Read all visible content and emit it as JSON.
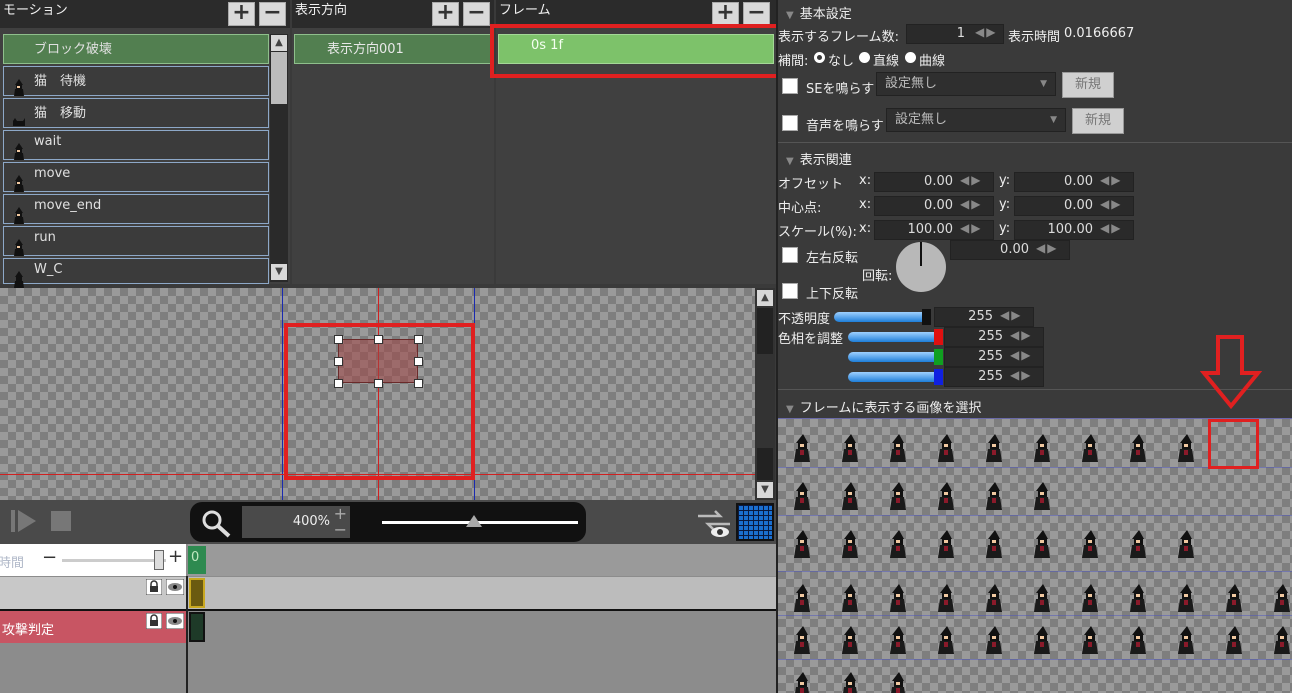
{
  "motion": {
    "header": "モーション",
    "items": [
      {
        "label": "ブロック破壊",
        "selected": true
      },
      {
        "label": "猫　待機",
        "selected": false
      },
      {
        "label": "猫　移動",
        "selected": false
      },
      {
        "label": "wait",
        "selected": false
      },
      {
        "label": "move",
        "selected": false
      },
      {
        "label": "move_end",
        "selected": false
      },
      {
        "label": "run",
        "selected": false
      },
      {
        "label": "W_C",
        "selected": false
      }
    ]
  },
  "direction": {
    "header": "表示方向",
    "items": [
      {
        "label": "表示方向001"
      }
    ]
  },
  "frame": {
    "header": "フレーム",
    "items": [
      {
        "label": "0s 1f"
      }
    ]
  },
  "icons": {
    "plus": "+",
    "minus": "−",
    "scroll_up": "▲",
    "scroll_down": "▼",
    "play": "▶",
    "stop": "■",
    "search": "search-icon"
  },
  "toolbar": {
    "zoom_value": "400%",
    "zoom_plus": "+",
    "zoom_minus": "−",
    "zoom_slider_level": 0.47
  },
  "timeline": {
    "time_label": "時間",
    "time_marker": "0",
    "tracks": [
      {
        "name": "",
        "color": "#c8c8c8"
      },
      {
        "name": "攻撃判定",
        "color": "#c85563"
      }
    ]
  },
  "basic": {
    "title": "基本設定",
    "frame_count_label": "表示するフレーム数:",
    "frame_count": "1",
    "display_time_label": "表示時間",
    "display_time": "0.0166667",
    "interp_label": "補間:",
    "interp_options": [
      "なし",
      "直線",
      "曲線"
    ],
    "interp_selected": 0,
    "se_label": "SEを鳴らす",
    "se_value": "設定無し",
    "se_new": "新規",
    "voice_label": "音声を鳴らす",
    "voice_value": "設定無し",
    "voice_new": "新規"
  },
  "display": {
    "title": "表示関連",
    "offset_label": "オフセット",
    "offset_x": "0.00",
    "offset_y": "0.00",
    "center_label": "中心点:",
    "center_x": "0.00",
    "center_y": "0.00",
    "scale_label": "スケール(%):",
    "scale_x": "100.00",
    "scale_y": "100.00",
    "x_label": "x:",
    "y_label": "y:",
    "flip_h_label": "左右反転",
    "rotation_label": "回転:",
    "rotation_value": "0.00",
    "flip_v_label": "上下反転",
    "opacity_label": "不透明度",
    "opacity_value": "255",
    "hue_label": "色相を調整",
    "hue_r": "255",
    "hue_g": "255",
    "hue_b": "255"
  },
  "image_select": {
    "title": "フレームに表示する画像を選択"
  },
  "colors": {
    "accent_red": "#e02020",
    "selected_green": "#7dc26a",
    "motion_selected": "#527f50",
    "attack_track": "#c85563"
  }
}
